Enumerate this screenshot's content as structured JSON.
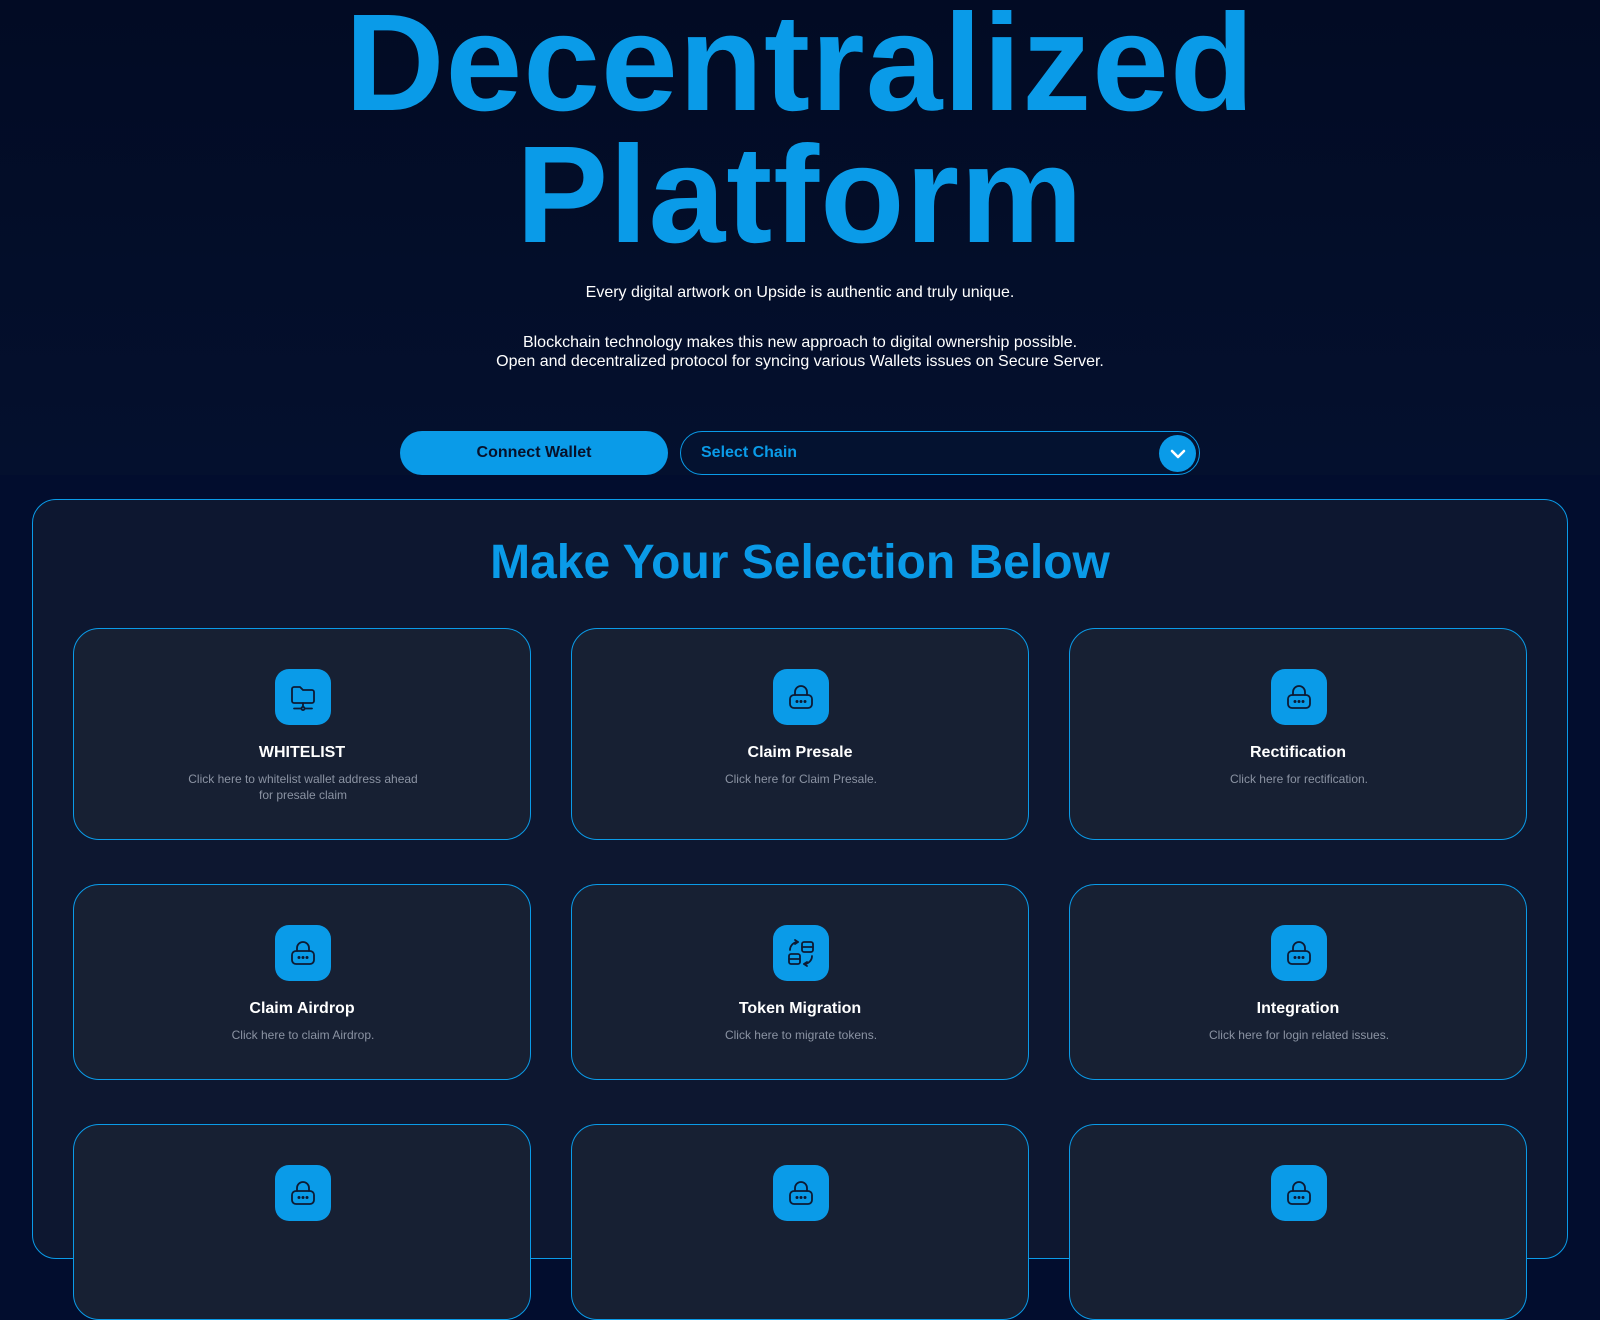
{
  "hero": {
    "title_line1": "Decentralized",
    "title_line2": "Platform",
    "tagline": "Every digital artwork on Upside is authentic and truly unique.",
    "description_line1": "Blockchain technology makes this new approach to digital ownership possible.",
    "description_line2": "Open and decentralized protocol for syncing various Wallets issues on Secure Server."
  },
  "actions": {
    "connect_wallet_label": "Connect Wallet",
    "select_chain_label": "Select Chain",
    "select_chain_icon": "chevron-down-icon"
  },
  "panel": {
    "title": "Make Your Selection Below"
  },
  "cards": [
    {
      "title": "WHITELIST",
      "description": "Click here to whitelist wallet address ahead for presale claim",
      "icon": "folder-network-icon"
    },
    {
      "title": "Claim Presale",
      "description": "Click here for Claim Presale.",
      "icon": "lock-icon"
    },
    {
      "title": "Rectification",
      "description": "Click here for rectification.",
      "icon": "lock-icon"
    },
    {
      "title": "Claim Airdrop",
      "description": "Click here to claim Airdrop.",
      "icon": "lock-icon"
    },
    {
      "title": "Token Migration",
      "description": "Click here to migrate tokens.",
      "icon": "migrate-icon"
    },
    {
      "title": "Integration",
      "description": "Click here for login related issues.",
      "icon": "lock-icon"
    },
    {
      "title": "",
      "description": "",
      "icon": "lock-icon"
    },
    {
      "title": "",
      "description": "",
      "icon": "lock-icon"
    },
    {
      "title": "",
      "description": "",
      "icon": "lock-icon"
    }
  ],
  "colors": {
    "accent": "#0a9be8",
    "background": "#020d2e",
    "panel": "#0d1730",
    "card": "#172033",
    "muted_text": "#8b93a3"
  }
}
